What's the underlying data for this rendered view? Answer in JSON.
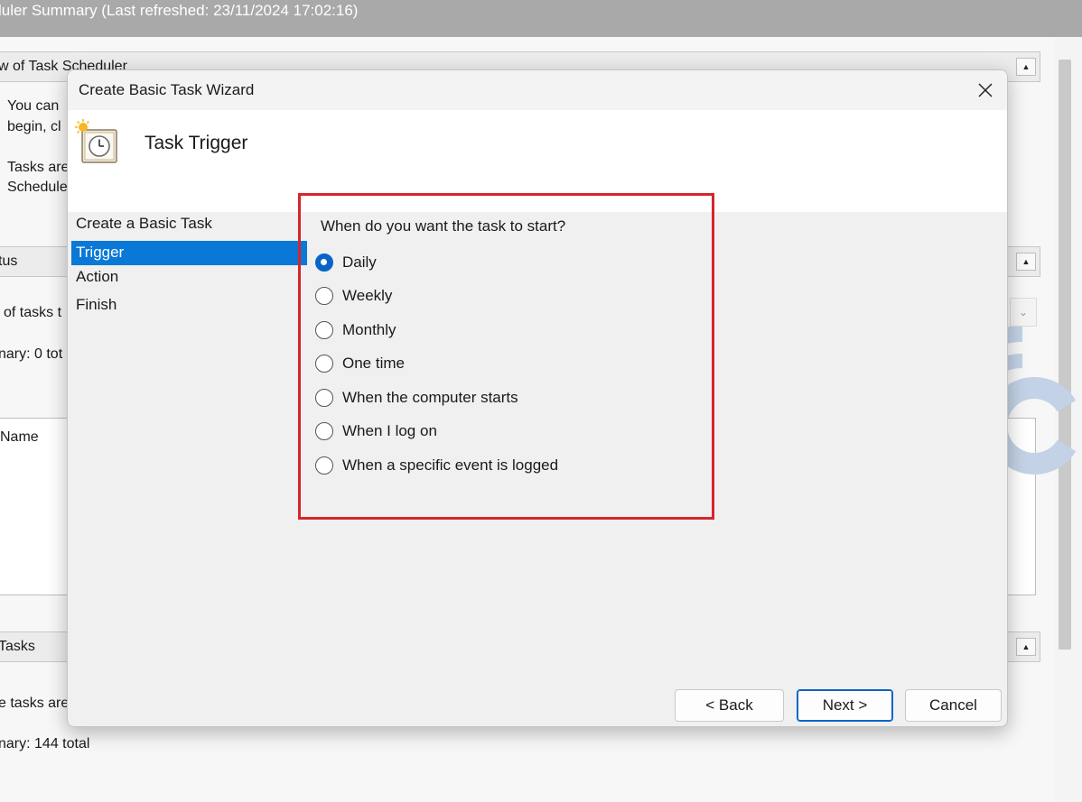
{
  "background": {
    "title": "luler Summary (Last refreshed: 23/11/2024 17:02:16)",
    "overview_header": "w of Task Scheduler",
    "overview_lines": [
      "You can",
      "begin, cl",
      "Tasks are",
      "Schedule"
    ],
    "status_header": "tus",
    "status_lines": [
      "of tasks t",
      "nary: 0 tot"
    ],
    "name_column": "Name",
    "active_header": "Tasks",
    "active_lines": [
      "e tasks are",
      "nary: 144 total"
    ],
    "collapse_glyph": "▲",
    "combo_glyph": "⌄"
  },
  "dialog": {
    "title": "Create Basic Task Wizard",
    "heading": "Task Trigger",
    "steps": [
      {
        "label": "Create a Basic Task",
        "active": false
      },
      {
        "label": "Trigger",
        "active": true
      },
      {
        "label": "Action",
        "active": false
      },
      {
        "label": "Finish",
        "active": false
      }
    ],
    "question": "When do you want the task to start?",
    "options": [
      {
        "label": "Daily",
        "checked": true
      },
      {
        "label": "Weekly",
        "checked": false
      },
      {
        "label": "Monthly",
        "checked": false
      },
      {
        "label": "One time",
        "checked": false
      },
      {
        "label": "When the computer starts",
        "checked": false
      },
      {
        "label": "When I log on",
        "checked": false
      },
      {
        "label": "When a specific event is logged",
        "checked": false
      }
    ],
    "buttons": {
      "back": "< Back",
      "next": "Next >",
      "cancel": "Cancel"
    }
  },
  "colors": {
    "accent": "#0a78d7",
    "highlight": "#d7252d",
    "watermark": "#c3d2e6"
  }
}
